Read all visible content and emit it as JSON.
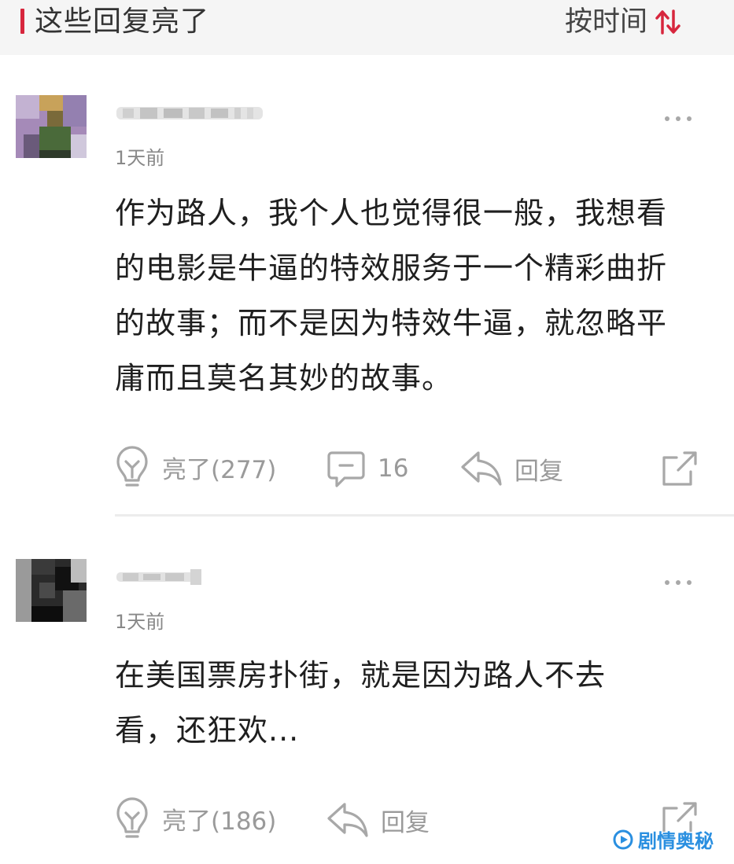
{
  "header": {
    "title": "这些回复亮了",
    "sort_label": "按时间"
  },
  "comments": [
    {
      "time": "1天前",
      "text": "作为路人，我个人也觉得很一般，我想看的电影是牛逼的特效服务于一个精彩曲折的故事；而不是因为特效牛逼，就忽略平庸而且莫名其妙的故事。",
      "like_label": "亮了(277)",
      "reply_count": "16",
      "reply_label": "回复"
    },
    {
      "time": "1天前",
      "text": "在美国票房扑街，就是因为路人不去看，还狂欢...",
      "like_label": "亮了(186)",
      "reply_label": "回复"
    }
  ],
  "watermark": {
    "text": "剧情奥秘",
    "icon": "play-logo-icon"
  },
  "colors": {
    "accent_red": "#d7263d",
    "icon_gray": "#9a9a9a",
    "watermark_blue": "#2a8fe0"
  }
}
